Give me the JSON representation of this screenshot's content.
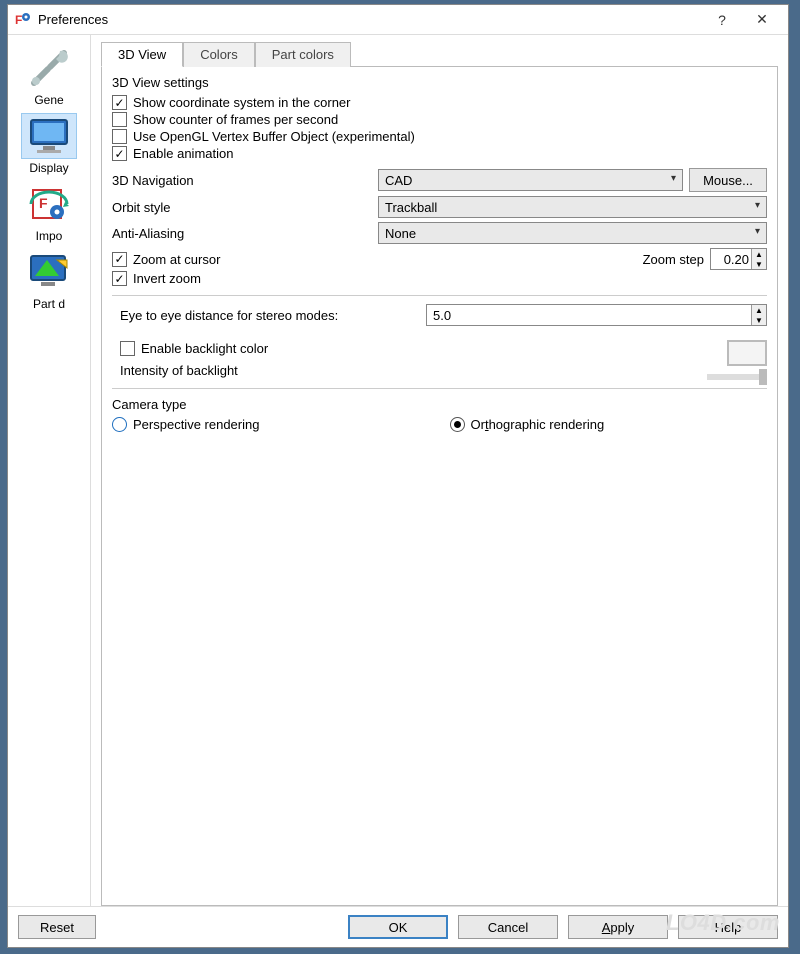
{
  "window": {
    "title": "Preferences"
  },
  "sidebar": {
    "items": [
      {
        "label": "Gene"
      },
      {
        "label": "Display"
      },
      {
        "label": "Impo"
      },
      {
        "label": "Part d"
      }
    ]
  },
  "tabs": {
    "items": [
      {
        "label": "3D View"
      },
      {
        "label": "Colors"
      },
      {
        "label": "Part colors"
      }
    ],
    "active": 0
  },
  "settings3d": {
    "group_title": "3D View settings",
    "show_coord": {
      "label": "Show coordinate system in the corner",
      "checked": true
    },
    "show_fps": {
      "label": "Show counter of frames per second",
      "checked": false
    },
    "use_vbo": {
      "label": "Use OpenGL Vertex Buffer Object (experimental)",
      "checked": false
    },
    "enable_anim": {
      "label": "Enable animation",
      "checked": true
    },
    "nav_label": "3D Navigation",
    "nav_value": "CAD",
    "mouse_btn": "Mouse...",
    "orbit_label": "Orbit style",
    "orbit_value": "Trackball",
    "aa_label": "Anti-Aliasing",
    "aa_value": "None",
    "zoom_cursor": {
      "label": "Zoom at cursor",
      "checked": true
    },
    "zoom_step_label": "Zoom step",
    "zoom_step_value": "0.20",
    "invert_zoom": {
      "label": "Invert zoom",
      "checked": true
    },
    "eye_label": "Eye to eye distance for stereo modes:",
    "eye_value": "5.0",
    "backlight": {
      "label": "Enable backlight color",
      "checked": false
    },
    "intensity_label": "Intensity of backlight"
  },
  "camera": {
    "group_title": "Camera type",
    "perspective": "Perspective rendering",
    "orthographic": "Orthographic rendering",
    "selected": "orthographic"
  },
  "footer": {
    "reset": "Reset",
    "ok": "OK",
    "cancel": "Cancel",
    "apply": "Apply",
    "help": "Help"
  },
  "watermark": "LO4D.com"
}
